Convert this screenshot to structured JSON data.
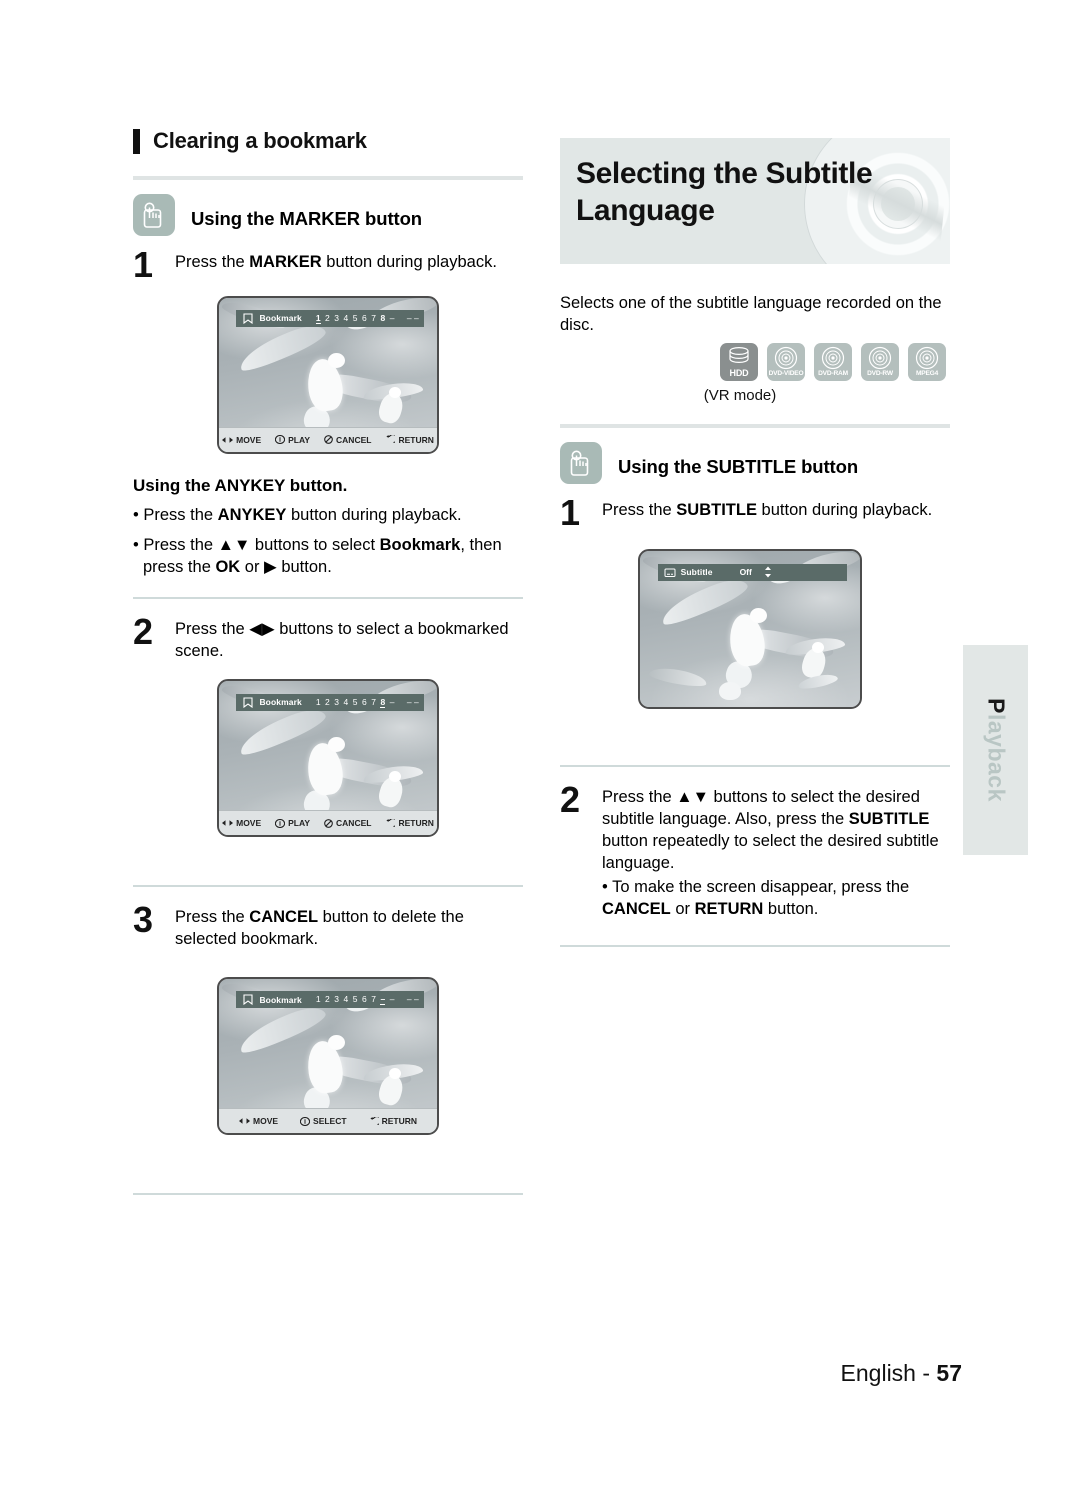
{
  "page": {
    "footer_prefix": "English - ",
    "footer_page": "57",
    "side_tab_label": "Playback",
    "side_tab_first": "P",
    "side_tab_rest": "layback"
  },
  "left_column": {
    "heading": "Clearing a bookmark",
    "marker_subhead": "Using the MARKER button",
    "marker_icon": "hand-press-button-icon",
    "step1": {
      "num": "1",
      "text_a": "Press the ",
      "bold_a": "MARKER",
      "text_b": " button during playback."
    },
    "screenshot1": {
      "osd_icon": "bookmark-icon",
      "osd_title": "Bookmark",
      "marks": [
        "1",
        "2",
        "3",
        "4",
        "5",
        "6",
        "7",
        "8"
      ],
      "selected_index": 0,
      "filled_index": 7,
      "dash_single": "–",
      "dash_double": "– –",
      "guide": [
        {
          "icon": "left-right-arrows-icon",
          "label": "MOVE"
        },
        {
          "icon": "ok-button-icon",
          "label": "PLAY"
        },
        {
          "icon": "cancel-icon",
          "label": "CANCEL"
        },
        {
          "icon": "return-arrow-icon",
          "label": "RETURN"
        }
      ]
    },
    "anykey_heading": "Using the ANYKEY button.",
    "anykey_bullet1_a": "• Press the ",
    "anykey_bullet1_b": "ANYKEY",
    "anykey_bullet1_c": " button during playback.",
    "anykey_bullet2_a": "• Press the ▲▼ buttons to select ",
    "anykey_bullet2_b": "Bookmark",
    "anykey_bullet2_c": ", then press the ",
    "anykey_bullet2_d": "OK",
    "anykey_bullet2_e": " or ▶ button.",
    "step2": {
      "num": "2",
      "text": "Press the ◀▶ buttons to select a bookmarked scene."
    },
    "screenshot2": {
      "osd_icon": "bookmark-icon",
      "osd_title": "Bookmark",
      "marks": [
        "1",
        "2",
        "3",
        "4",
        "5",
        "6",
        "7",
        "8"
      ],
      "selected_index": 7,
      "filled_index": 7,
      "dash_single": "–",
      "dash_double": "– –",
      "guide": [
        {
          "icon": "left-right-arrows-icon",
          "label": "MOVE"
        },
        {
          "icon": "ok-button-icon",
          "label": "PLAY"
        },
        {
          "icon": "cancel-icon",
          "label": "CANCEL"
        },
        {
          "icon": "return-arrow-icon",
          "label": "RETURN"
        }
      ]
    },
    "step3": {
      "num": "3",
      "text_a": "Press the ",
      "bold_a": "CANCEL",
      "text_b": " button to delete the selected bookmark."
    },
    "screenshot3": {
      "osd_icon": "bookmark-icon",
      "osd_title": "Bookmark",
      "marks": [
        "1",
        "2",
        "3",
        "4",
        "5",
        "6",
        "7"
      ],
      "empty_selected": "–",
      "dash_single": "–",
      "dash_double": "– –",
      "guide": [
        {
          "icon": "left-right-arrows-icon",
          "label": "MOVE"
        },
        {
          "icon": "ok-button-icon",
          "label": "SELECT"
        },
        {
          "icon": "return-arrow-icon",
          "label": "RETURN"
        }
      ]
    }
  },
  "right_column": {
    "title_line1": "Selecting the Subtitle",
    "title_line2": "Language",
    "title_disc_icon": "dvd-disc-illustration",
    "intro": "Selects one of the subtitle language recorded on the disc.",
    "disc_types": [
      {
        "label": "HDD",
        "glyph": "hdd-stack-icon",
        "dark": true
      },
      {
        "label": "DVD-VIDEO",
        "glyph": "disc-icon",
        "dark": false
      },
      {
        "label": "DVD-RAM",
        "glyph": "disc-icon",
        "dark": false
      },
      {
        "label": "DVD-RW",
        "glyph": "disc-icon",
        "dark": false
      },
      {
        "label": "MPEG4",
        "glyph": "disc-icon",
        "dark": false
      }
    ],
    "vr_mode": "(VR mode)",
    "subtitle_subhead": "Using the SUBTITLE button",
    "subtitle_icon": "hand-press-button-icon",
    "step1": {
      "num": "1",
      "text_a": "Press the ",
      "bold_a": "SUBTITLE",
      "text_b": " button during playback."
    },
    "screenshot": {
      "osd_icon": "subtitle-icon",
      "osd_title": "Subtitle",
      "osd_value": "Off",
      "osd_spinner": "updown-arrows-icon"
    },
    "step2": {
      "num": "2",
      "text_a": "Press the ▲▼ buttons to select the desired subtitle language. Also, press the ",
      "bold_a": "SUBTITLE",
      "text_b": " button repeatedly to select the desired subtitle language.",
      "bullet_a": "• To make the screen disappear, press the ",
      "bullet_bold_1": "CANCEL",
      "bullet_mid": " or ",
      "bullet_bold_2": "RETURN",
      "bullet_end": " button."
    }
  }
}
